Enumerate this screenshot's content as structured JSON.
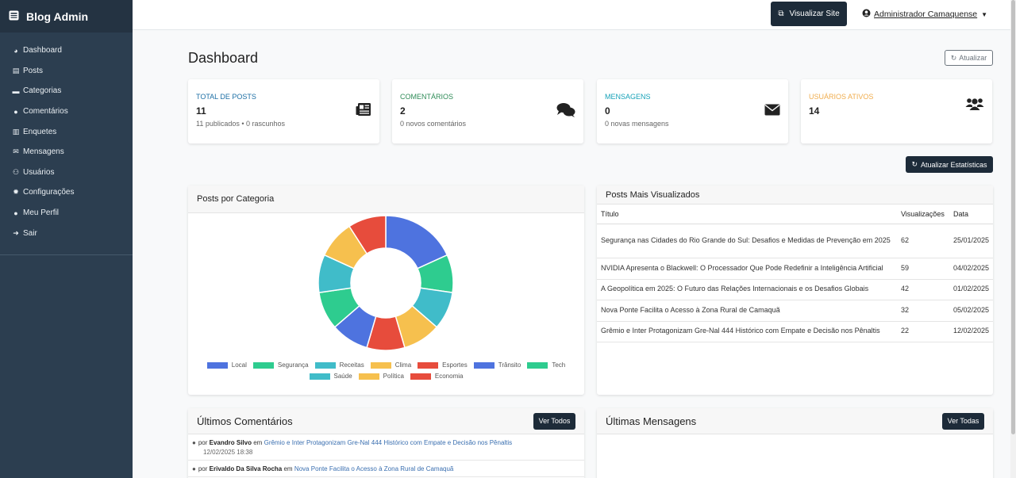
{
  "sidebar": {
    "brand": "Blog Admin",
    "items": [
      {
        "label": "Dashboard",
        "icon": "tachometer-icon"
      },
      {
        "label": "Posts",
        "icon": "file-icon"
      },
      {
        "label": "Categorias",
        "icon": "folder-icon"
      },
      {
        "label": "Comentários",
        "icon": "comments-icon"
      },
      {
        "label": "Enquetes",
        "icon": "poll-icon"
      },
      {
        "label": "Mensagens",
        "icon": "envelope-icon"
      },
      {
        "label": "Usuários",
        "icon": "users-icon"
      },
      {
        "label": "Configurações",
        "icon": "gear-icon"
      },
      {
        "label": "Meu Perfil",
        "icon": "user-icon"
      },
      {
        "label": "Sair",
        "icon": "sign-out-icon"
      }
    ]
  },
  "topbar": {
    "view_site": "Visualizar Site",
    "user_name": "Administrador Camaquense"
  },
  "page": {
    "title": "Dashboard",
    "refresh": "Atualizar",
    "refresh_stats": "Atualizar Estatísticas"
  },
  "stats": [
    {
      "label": "Total de Posts",
      "value": "11",
      "sub": "11 publicados • 0 rascunhos",
      "color": "#1d6fa5",
      "icon": "newspaper-icon"
    },
    {
      "label": "Comentários",
      "value": "2",
      "sub": "0 novos comentários",
      "color": "#2e8b57",
      "icon": "comments-icon"
    },
    {
      "label": "Mensagens",
      "value": "0",
      "sub": "0 novas mensagens",
      "color": "#17a2b8",
      "icon": "envelope-icon"
    },
    {
      "label": "Usuários Ativos",
      "value": "14",
      "sub": "",
      "color": "#f0ad4e",
      "icon": "users-icon"
    }
  ],
  "category_card": {
    "title": "Posts por Categoria"
  },
  "chart_data": {
    "type": "pie",
    "categories": [
      "Local",
      "Segurança",
      "Receitas",
      "Clima",
      "Esportes",
      "Trânsito",
      "Tech",
      "Saúde",
      "Política",
      "Economia"
    ],
    "values": [
      2,
      1,
      1,
      1,
      1,
      1,
      1,
      1,
      1,
      1
    ],
    "colors": [
      "#4e73df",
      "#2ecc8f",
      "#40bcc9",
      "#f6c04e",
      "#e74c3c",
      "#4e73df",
      "#2ecc8f",
      "#40bcc9",
      "#f6c04e",
      "#e74c3c"
    ],
    "legend_position": "bottom",
    "donut": true
  },
  "most_viewed": {
    "title": "Posts Mais Visualizados",
    "headers": [
      "Título",
      "Visualizações",
      "Data"
    ],
    "rows": [
      {
        "title": "Segurança nas Cidades do Rio Grande do Sul: Desafios e Medidas de Prevenção em 2025",
        "views": "62",
        "date": "25/01/2025"
      },
      {
        "title": "NVIDIA Apresenta o Blackwell: O Processador Que Pode Redefinir a Inteligência Artificial",
        "views": "59",
        "date": "04/02/2025"
      },
      {
        "title": "A Geopolítica em 2025: O Futuro das Relações Internacionais e os Desafios Globais",
        "views": "42",
        "date": "01/02/2025"
      },
      {
        "title": "Nova Ponte Facilita o Acesso à Zona Rural de Camaquã",
        "views": "32",
        "date": "05/02/2025"
      },
      {
        "title": "Grêmio e Inter Protagonizam Gre-Nal 444 Histórico com Empate e Decisão nos Pênaltis",
        "views": "22",
        "date": "12/02/2025"
      }
    ]
  },
  "comments": {
    "title": "Últimos Comentários",
    "ver_todos": "Ver Todos",
    "items": [
      {
        "by": "por",
        "author": "Evandro Silvo",
        "in": "em",
        "post": "Grêmio e Inter Protagonizam Gre-Nal 444 Histórico com Empate e Decisão nos Pênaltis",
        "date": "12/02/2025 18:38"
      },
      {
        "by": "por",
        "author": "Erivaldo Da Silva Rocha",
        "in": "em",
        "post": "Nova Ponte Facilita o Acesso à Zona Rural de Camaquã",
        "date": ""
      }
    ]
  },
  "messages": {
    "title": "Últimas Mensagens",
    "ver_todos": "Ver Todas"
  }
}
